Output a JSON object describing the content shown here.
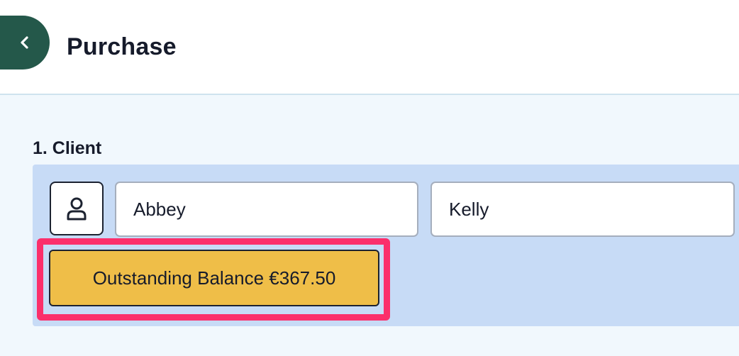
{
  "header": {
    "title": "Purchase",
    "back_icon": "chevron-left-icon"
  },
  "client_section": {
    "heading": "1. Client",
    "icon": "user-icon",
    "first_name": "Abbey",
    "last_name": "Kelly",
    "balance_button_label": "Outstanding Balance €367.50"
  },
  "colors": {
    "brand_green": "#24584a",
    "panel_blue": "#c7dbf6",
    "content_bg": "#f1f8fd",
    "balance_yellow": "#efbe48",
    "highlight_pink": "#fb2f6b"
  }
}
